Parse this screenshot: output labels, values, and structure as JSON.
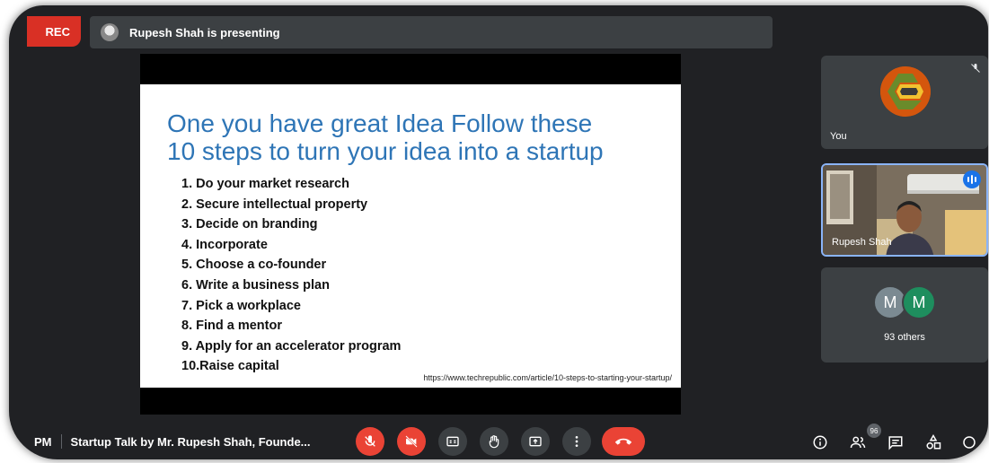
{
  "recording": {
    "label": "REC"
  },
  "presenter_bar": {
    "text": "Rupesh Shah is presenting"
  },
  "slide": {
    "title_line1": "One you have great Idea Follow these",
    "title_line2": "10 steps to turn your idea into a startup",
    "steps": [
      "1.  Do your market research",
      "2.  Secure intellectual property",
      "3.  Decide on branding",
      "4.  Incorporate",
      "5.  Choose a co-founder",
      "6.  Write a business plan",
      "7.  Pick a workplace",
      "8.  Find a mentor",
      "9.  Apply for an accelerator program",
      "10.Raise capital"
    ],
    "source": "https://www.techrepublic.com/article/10-steps-to-starting-your-startup/"
  },
  "participants": {
    "you_label": "You",
    "rupesh_label": "Rupesh Shah",
    "others_initials": [
      "M",
      "M"
    ],
    "others_label": "93 others"
  },
  "bottom_bar": {
    "time": "PM",
    "meeting_title": "Startup Talk by Mr. Rupesh Shah, Founde...",
    "people_count": "96"
  },
  "colors": {
    "background": "#202124",
    "tile": "#3c4043",
    "red": "#ea4335",
    "accent_blue": "#1a73e8",
    "slide_title": "#2e75b6"
  }
}
